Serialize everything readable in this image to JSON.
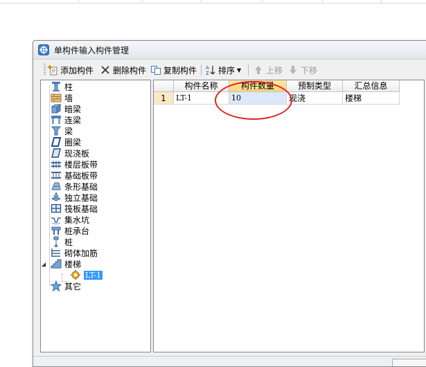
{
  "window": {
    "title": "单构件输入构件管理"
  },
  "toolbar": {
    "add_label": "添加构件",
    "delete_label": "删除构件",
    "copy_label": "复制构件",
    "sort_label": "排序",
    "move_up_label": "上移",
    "move_down_label": "下移"
  },
  "tree": {
    "items": [
      {
        "label": "柱",
        "icon": "column-icon"
      },
      {
        "label": "墙",
        "icon": "wall-icon"
      },
      {
        "label": "暗梁",
        "icon": "hidden-beam-icon"
      },
      {
        "label": "连梁",
        "icon": "coupling-beam-icon"
      },
      {
        "label": "梁",
        "icon": "beam-icon"
      },
      {
        "label": "圈梁",
        "icon": "ring-beam-icon"
      },
      {
        "label": "现浇板",
        "icon": "slab-icon"
      },
      {
        "label": "楼层板带",
        "icon": "floor-strip-icon"
      },
      {
        "label": "基础板带",
        "icon": "foundation-strip-icon"
      },
      {
        "label": "条形基础",
        "icon": "strip-foundation-icon"
      },
      {
        "label": "独立基础",
        "icon": "isolated-foundation-icon"
      },
      {
        "label": "筏板基础",
        "icon": "raft-foundation-icon"
      },
      {
        "label": "集水坑",
        "icon": "sump-icon"
      },
      {
        "label": "桩承台",
        "icon": "pile-cap-icon"
      },
      {
        "label": "桩",
        "icon": "pile-icon"
      },
      {
        "label": "砌体加筋",
        "icon": "masonry-rebar-icon"
      },
      {
        "label": "楼梯",
        "icon": "stair-icon"
      },
      {
        "label": "LT-1",
        "icon": "component-gear-icon"
      },
      {
        "label": "其它",
        "icon": "star-icon"
      }
    ]
  },
  "grid": {
    "columns": [
      "构件名称",
      "构件数量",
      "预制类型",
      "汇总信息"
    ],
    "rows": [
      {
        "index": "1",
        "name": "LT-1",
        "quantity": "10",
        "prefab_type": "现浇",
        "summary": "楼梯"
      }
    ]
  },
  "colors": {
    "selection": "#3399ff",
    "active_header": "#fbd47a",
    "annotation_circle": "#e02020"
  }
}
